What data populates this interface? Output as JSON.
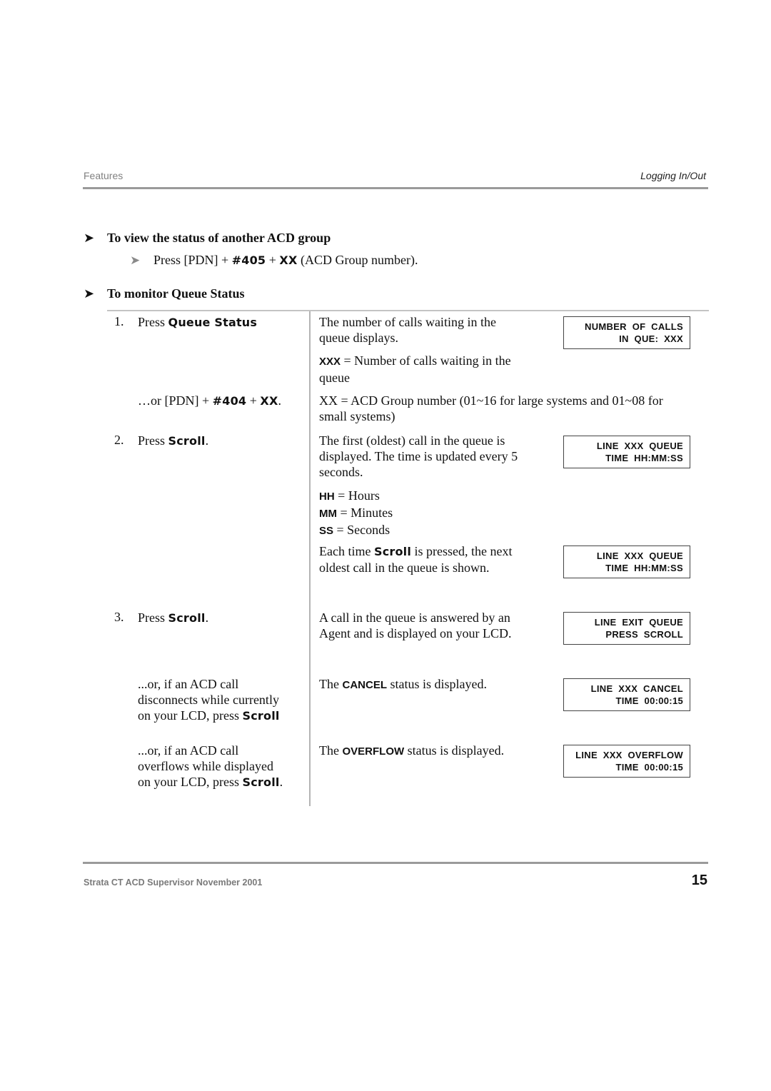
{
  "header": {
    "section": "Features",
    "topic": "Logging In/Out"
  },
  "procedure1": {
    "title": "To view the status of another ACD group",
    "step": {
      "prefix": "Press [PDN] + ",
      "code": "#405",
      "plus": " + ",
      "xx": "XX",
      "suffix": " (ACD Group number)."
    }
  },
  "procedure2": {
    "title": "To monitor Queue Status",
    "rows": [
      {
        "num": "1.",
        "action_prefix": "Press ",
        "action_key": "Queue Status",
        "desc": [
          "The number of calls waiting in the",
          "queue displays."
        ],
        "lcd": [
          "NUMBER  OF  CALLS",
          "IN  QUE:  XXX"
        ]
      },
      {
        "desc_key": "XXX",
        "desc": [
          "= Number of calls waiting in the",
          "queue"
        ]
      },
      {
        "action_prefix": "…or [PDN] + ",
        "action_code": "#404",
        "action_plus": " + ",
        "action_xx": "XX",
        "action_suffix": ".",
        "desc": [
          "XX = ACD Group number (01~16 for large systems and 01~08 for",
          "small systems)"
        ]
      },
      {
        "num": "2.",
        "action_prefix": "Press ",
        "action_key": "Scroll",
        "action_suffix": ".",
        "desc": [
          "The first (oldest) call in the queue is",
          "displayed. The time is updated every 5",
          "seconds."
        ],
        "lcd": [
          "LINE  XXX  QUEUE",
          "TIME  HH:MM:SS"
        ]
      },
      {
        "legend": [
          {
            "key": "HH",
            "text": " = Hours"
          },
          {
            "key": "MM",
            "text": " = Minutes"
          },
          {
            "key": "SS",
            "text": " = Seconds"
          }
        ]
      },
      {
        "desc_prefix": "Each time ",
        "desc_key": "Scroll",
        "desc_line1_suffix": " is pressed, the next",
        "desc_line2": "oldest call in the queue is shown.",
        "lcd": [
          "LINE  XXX  QUEUE",
          "TIME  HH:MM:SS"
        ]
      },
      {
        "num": "3.",
        "action_prefix": "Press ",
        "action_key": "Scroll",
        "action_suffix": ".",
        "desc": [
          "A call in the queue is answered by an",
          "Agent and is displayed on your LCD."
        ],
        "lcd": [
          "LINE  EXIT  QUEUE",
          "PRESS  SCROLL"
        ]
      },
      {
        "action_lines": [
          "...or, if an ACD call",
          "disconnects while currently",
          "on your LCD, press "
        ],
        "action_key": "Scroll",
        "action_suffix": "",
        "desc_prefix": "The ",
        "desc_key": "CANCEL",
        "desc_suffix": " status is displayed.",
        "lcd": [
          "LINE  XXX  CANCEL",
          "TIME  00:00:15"
        ]
      },
      {
        "action_lines": [
          "...or, if an ACD call",
          "overflows while displayed",
          "on your LCD, press "
        ],
        "action_key": "Scroll",
        "action_suffix": ".",
        "desc_prefix": "The ",
        "desc_key": "OVERFLOW",
        "desc_suffix": " status is displayed.",
        "lcd": [
          "LINE  XXX  OVERFLOW",
          "TIME  00:00:15"
        ]
      }
    ]
  },
  "footer": {
    "title": "Strata CT ACD Supervisor  November 2001",
    "page_number": "15"
  }
}
